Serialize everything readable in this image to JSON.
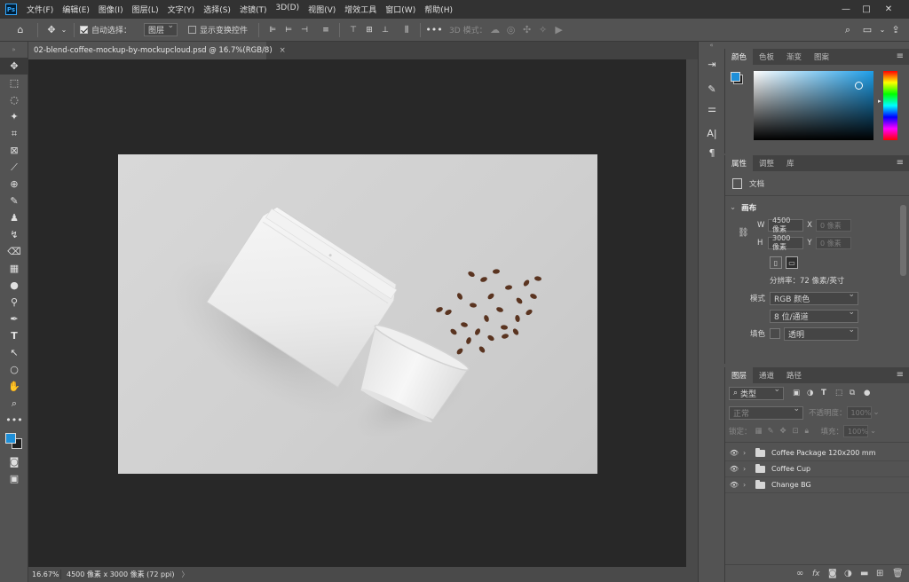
{
  "app": {
    "logo": "Ps"
  },
  "menu": [
    "文件(F)",
    "编辑(E)",
    "图像(I)",
    "图层(L)",
    "文字(Y)",
    "选择(S)",
    "滤镜(T)",
    "3D(D)",
    "视图(V)",
    "增效工具",
    "窗口(W)",
    "帮助(H)"
  ],
  "window_controls": {
    "minimize": "—",
    "maximize": "□",
    "close": "✕"
  },
  "options": {
    "auto_select_label": "自动选择：",
    "auto_select_value": "图层",
    "show_transform_label": "显示变换控件",
    "more": "•••",
    "mode_3d_label": "3D 模式："
  },
  "document": {
    "tab_title": "02-blend-coffee-mockup-by-mockupcloud.psd @ 16.7%(RGB/8)",
    "tab_close": "×",
    "zoom": "16.67%",
    "info": "4500 像素 x 3000 像素 (72 ppi)",
    "arrow": "〉"
  },
  "color_panel": {
    "tabs": [
      "颜色",
      "色板",
      "渐变",
      "图案"
    ],
    "foreground": "#1e8fd8",
    "background": "#1f1f1f"
  },
  "properties_panel": {
    "tabs": [
      "属性",
      "调整",
      "库"
    ],
    "doc_label": "文档",
    "section": "画布",
    "w_label": "W",
    "w_value": "4500 像素",
    "x_label": "X",
    "x_placeholder": "0 像素",
    "h_label": "H",
    "h_value": "3000 像素",
    "y_label": "Y",
    "y_placeholder": "0 像素",
    "resolution": "分辨率：72 像素/英寸",
    "mode_label": "模式",
    "mode_value": "RGB 颜色",
    "depth_value": "8 位/通道",
    "fill_label": "填色",
    "fill_value": "透明"
  },
  "layers_panel": {
    "tabs": [
      "图层",
      "通道",
      "路径"
    ],
    "filter_value": "类型",
    "blend_mode": "正常",
    "opacity_label": "不透明度：",
    "opacity_value": "100%",
    "lock_label": "锁定：",
    "fill_label": "填充：",
    "fill_value": "100%",
    "layers": [
      {
        "name": "Coffee Package 120x200 mm"
      },
      {
        "name": "Coffee Cup"
      },
      {
        "name": "Change BG"
      }
    ]
  }
}
